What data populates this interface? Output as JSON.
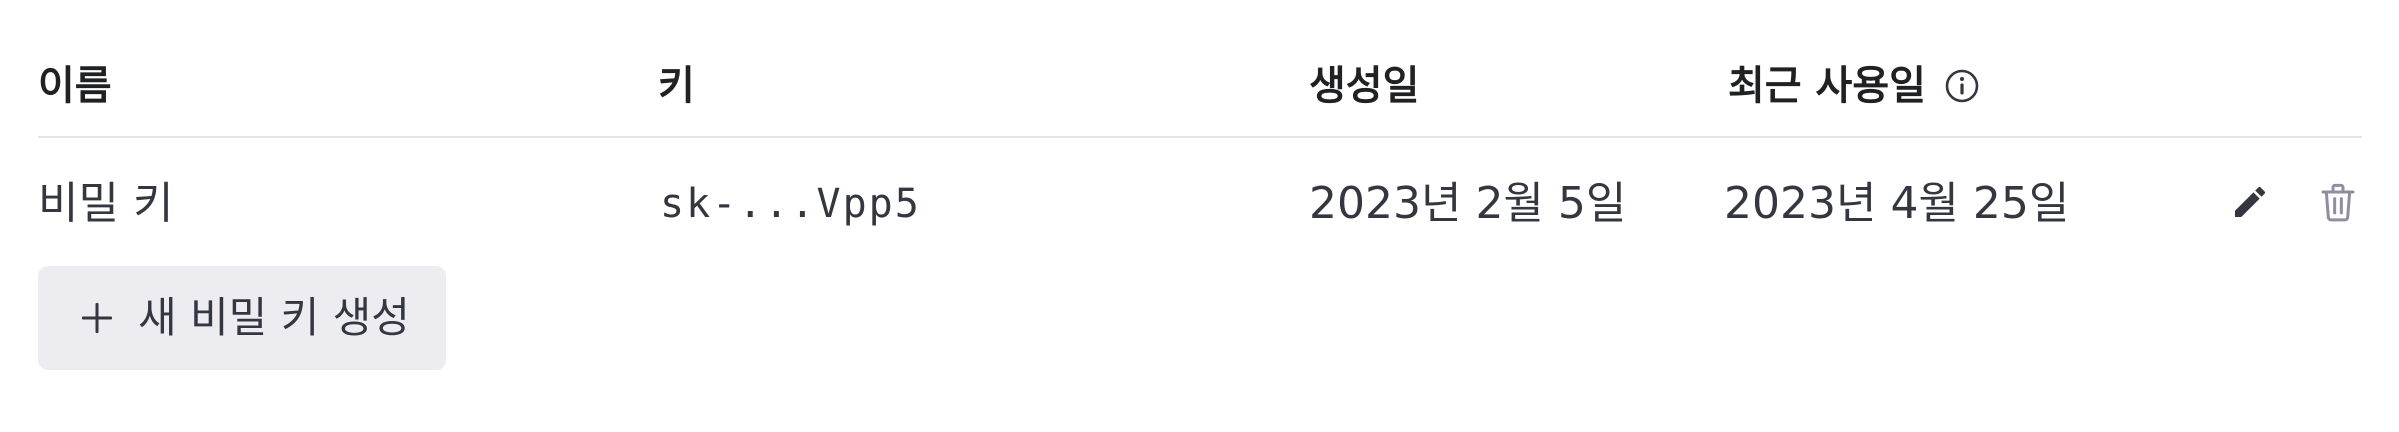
{
  "table": {
    "headers": {
      "name": "이름",
      "key": "키",
      "created": "생성일",
      "last_used": "최근 사용일"
    },
    "rows": [
      {
        "name": "비밀 키",
        "key": "sk-...Vpp5",
        "created": "2023년 2월 5일",
        "last_used": "2023년 4월 25일"
      }
    ]
  },
  "icons": {
    "info": "info-circle-icon",
    "edit": "pencil-icon",
    "delete": "trash-icon",
    "add": "plus-icon"
  },
  "create_button": {
    "label": "새 비밀 키 생성"
  },
  "colors": {
    "text_primary": "#202123",
    "text_body": "#353740",
    "divider": "#e5e5e8",
    "button_bg": "#ececf1",
    "icon_muted": "#8e8ea0"
  }
}
